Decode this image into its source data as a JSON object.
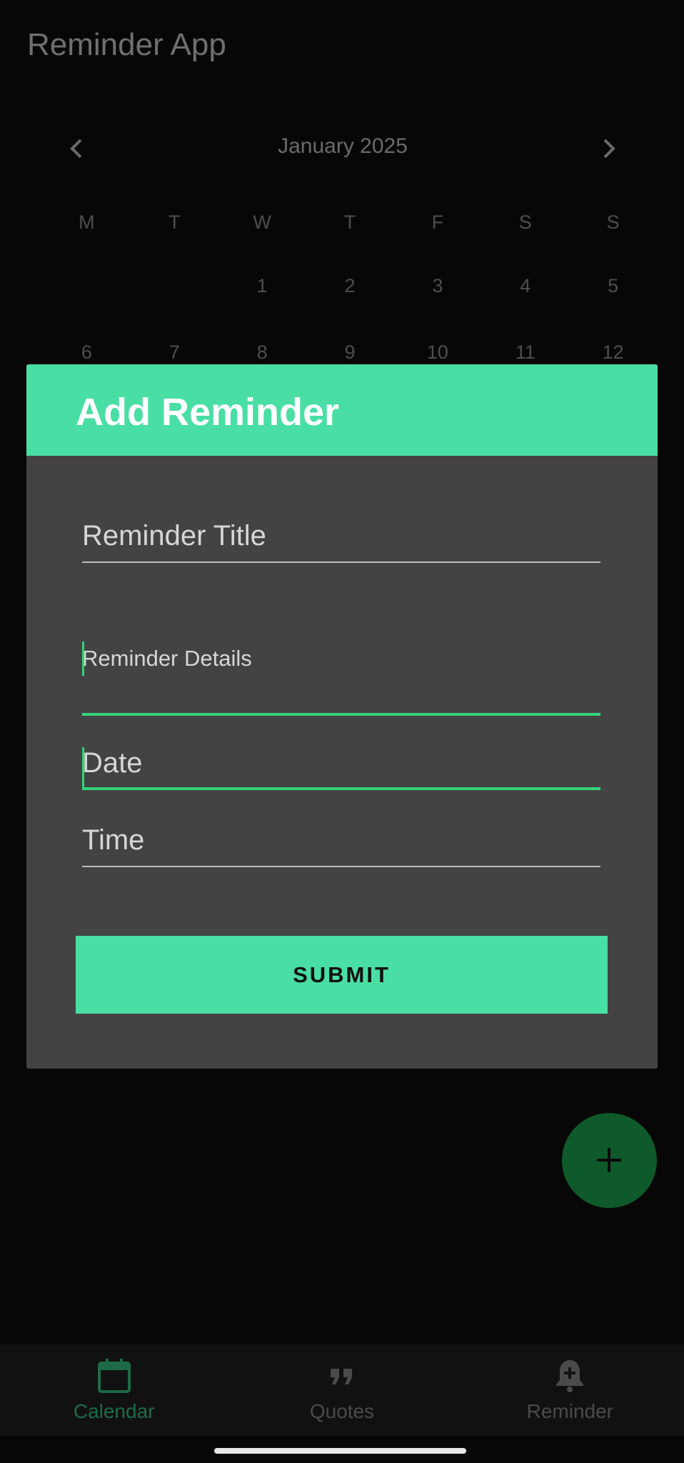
{
  "app": {
    "title": "Reminder App"
  },
  "calendar": {
    "month_label": "January 2025",
    "weekdays": [
      "M",
      "T",
      "W",
      "T",
      "F",
      "S",
      "S"
    ],
    "weeks": [
      [
        "",
        "",
        "1",
        "2",
        "3",
        "4",
        "5"
      ],
      [
        "6",
        "7",
        "8",
        "9",
        "10",
        "11",
        "12"
      ]
    ]
  },
  "dialog": {
    "title": "Add Reminder",
    "fields": {
      "title_placeholder": "Reminder Title",
      "details_placeholder": "Reminder Details",
      "date_placeholder": "Date",
      "time_placeholder": "Time"
    },
    "submit_label": "SUBMIT"
  },
  "fab": {
    "icon": "plus-icon"
  },
  "bottom_nav": {
    "items": [
      {
        "label": "Calendar",
        "icon": "calendar-icon",
        "active": true
      },
      {
        "label": "Quotes",
        "icon": "quote-icon",
        "active": false
      },
      {
        "label": "Reminder",
        "icon": "add-alarm-icon",
        "active": false
      }
    ]
  },
  "colors": {
    "accent": "#49dea3",
    "focus_line": "#34d37a",
    "dialog_bg": "#434343",
    "fab_bg": "#0f5a2a",
    "nav_active": "#1e6b48"
  }
}
